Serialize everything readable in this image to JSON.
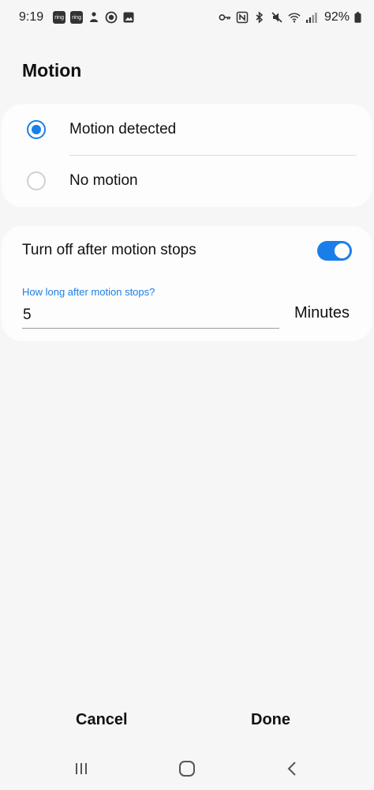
{
  "status_bar": {
    "time": "9:19",
    "left_icons": [
      "ring-icon",
      "ring-icon",
      "smartthings-icon",
      "circle-record-icon",
      "gallery-icon"
    ],
    "ring_text": "ring",
    "right_icons": [
      "key-icon",
      "nfc-icon",
      "bluetooth-icon",
      "mute-icon",
      "wifi-icon",
      "signal-icon"
    ],
    "battery": "92%"
  },
  "page": {
    "title": "Motion"
  },
  "motion_options": {
    "selected": "Motion detected",
    "items": [
      {
        "label": "Motion detected",
        "checked": true
      },
      {
        "label": "No motion",
        "checked": false
      }
    ]
  },
  "timer_card": {
    "toggle_label": "Turn off after motion stops",
    "toggle_on": true,
    "field_label": "How long after motion stops?",
    "field_value": "5",
    "unit": "Minutes"
  },
  "actions": {
    "cancel": "Cancel",
    "done": "Done"
  },
  "nav": [
    "recents-icon",
    "home-icon",
    "back-icon"
  ],
  "colors": {
    "accent": "#1a7ee8",
    "background": "#f6f6f6",
    "card": "#fdfdfd"
  }
}
